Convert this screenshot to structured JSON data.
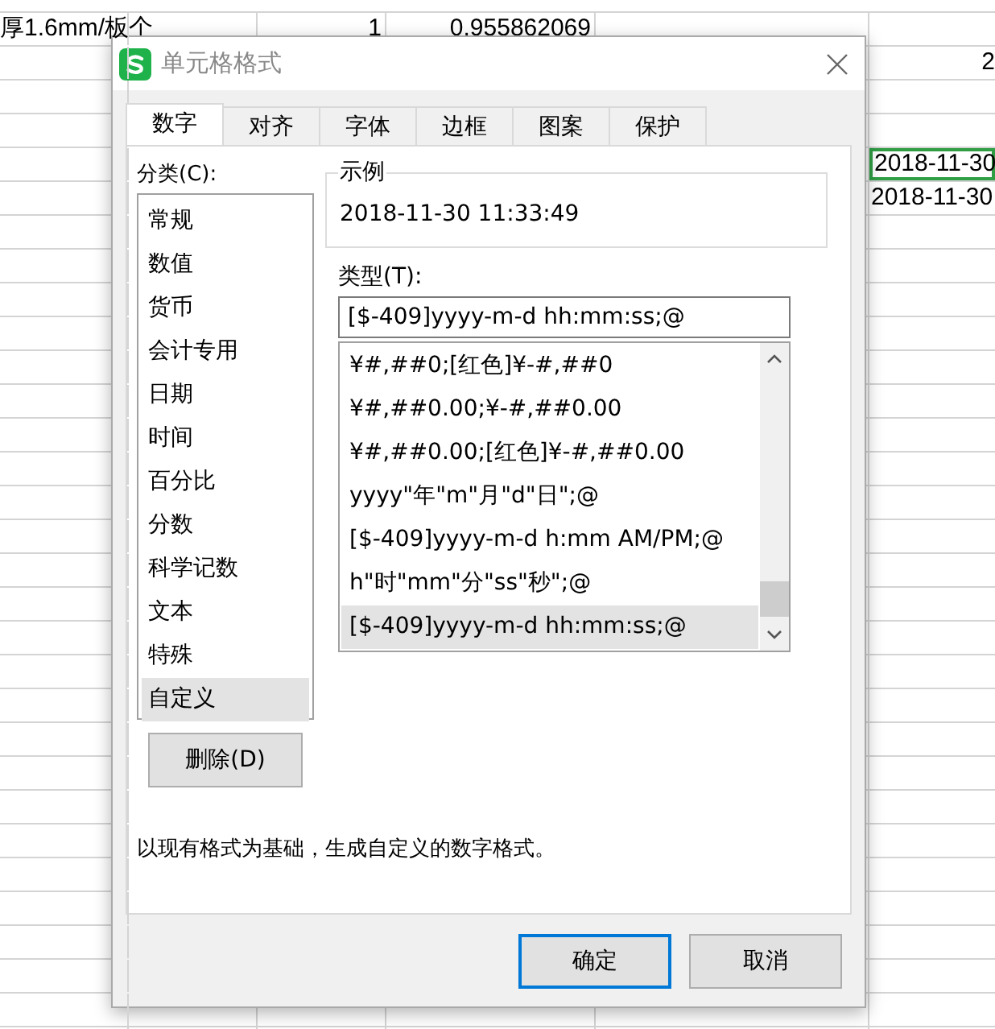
{
  "sheet": {
    "rows": [
      {
        "column_1": "厚1.6mm/板",
        "column_2": "个",
        "column_3": "1",
        "column_4": "0.955862069"
      },
      {
        "column_6": "2"
      },
      {
        "column_6": "2018-11-30",
        "selected": true
      },
      {
        "column_6": "2018-11-30",
        "selected": false
      }
    ]
  },
  "dialog": {
    "title": "单元格格式",
    "tabs": [
      {
        "label": "数字",
        "selected": true
      },
      {
        "label": "对齐",
        "selected": false
      },
      {
        "label": "字体",
        "selected": false
      },
      {
        "label": "边框",
        "selected": false
      },
      {
        "label": "图案",
        "selected": false
      },
      {
        "label": "保护",
        "selected": false
      }
    ],
    "category": {
      "label": "分类(C):",
      "items": [
        {
          "label": "常规",
          "selected": false
        },
        {
          "label": "数值",
          "selected": false
        },
        {
          "label": "货币",
          "selected": false
        },
        {
          "label": "会计专用",
          "selected": false
        },
        {
          "label": "日期",
          "selected": false
        },
        {
          "label": "时间",
          "selected": false
        },
        {
          "label": "百分比",
          "selected": false
        },
        {
          "label": "分数",
          "selected": false
        },
        {
          "label": "科学记数",
          "selected": false
        },
        {
          "label": "文本",
          "selected": false
        },
        {
          "label": "特殊",
          "selected": false
        },
        {
          "label": "自定义",
          "selected": true
        }
      ]
    },
    "sample": {
      "label": "示例",
      "value": "2018-11-30 11:33:49"
    },
    "type": {
      "label": "类型(T):",
      "value": "[$-409]yyyy-m-d hh:mm:ss;@",
      "items": [
        {
          "label": "¥#,##0;[红色]¥-#,##0",
          "selected": false
        },
        {
          "label": "¥#,##0.00;¥-#,##0.00",
          "selected": false
        },
        {
          "label": "¥#,##0.00;[红色]¥-#,##0.00",
          "selected": false
        },
        {
          "label": "yyyy\"年\"m\"月\"d\"日\";@",
          "selected": false
        },
        {
          "label": "[$-409]yyyy-m-d h:mm AM/PM;@",
          "selected": false
        },
        {
          "label": "h\"时\"mm\"分\"ss\"秒\";@",
          "selected": false
        },
        {
          "label": "[$-409]yyyy-m-d hh:mm:ss;@",
          "selected": true
        }
      ]
    },
    "delete_button": "删除(D)",
    "description": "以现有格式为基础，生成自定义的数字格式。",
    "buttons": [
      {
        "label": "确定",
        "kind": "primary"
      },
      {
        "label": "取消",
        "kind": "secondary"
      }
    ]
  }
}
